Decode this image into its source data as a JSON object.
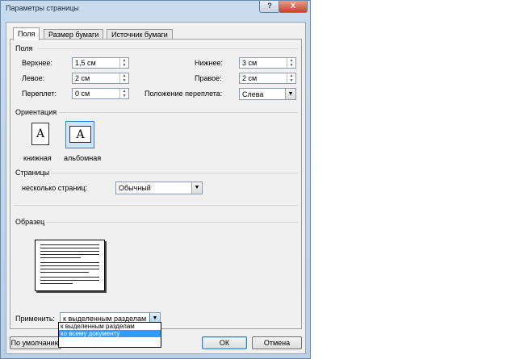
{
  "window": {
    "title": "Параметры страницы",
    "help": "?",
    "close": "X"
  },
  "tabs": [
    "Поля",
    "Размер бумаги",
    "Источник бумаги"
  ],
  "margins": {
    "section": "Поля",
    "top_label": "Верхнее:",
    "top_value": "1,5 см",
    "bottom_label": "Нижнее:",
    "bottom_value": "3 см",
    "left_label": "Левое:",
    "left_value": "2 см",
    "right_label": "Правое:",
    "right_value": "2 см",
    "gutter_label": "Переплет:",
    "gutter_value": "0 см",
    "gutter_pos_label": "Положение переплета:",
    "gutter_pos_value": "Слева"
  },
  "orientation": {
    "section": "Ориентация",
    "glyph": "A",
    "portrait": "книжная",
    "landscape": "альбомная",
    "selected": "альбомная"
  },
  "pages": {
    "section": "Страницы",
    "multiple_label": "несколько страниц:",
    "multiple_value": "Обычный"
  },
  "preview": {
    "section": "Образец"
  },
  "apply": {
    "label": "Применить:",
    "value": "к выделенным разделам",
    "options": [
      "к выделенным разделам",
      "ко всему документу"
    ],
    "highlighted": "ко всему документу"
  },
  "buttons": {
    "default": "По умолчанию",
    "ok": "ОК",
    "cancel": "Отмена"
  }
}
